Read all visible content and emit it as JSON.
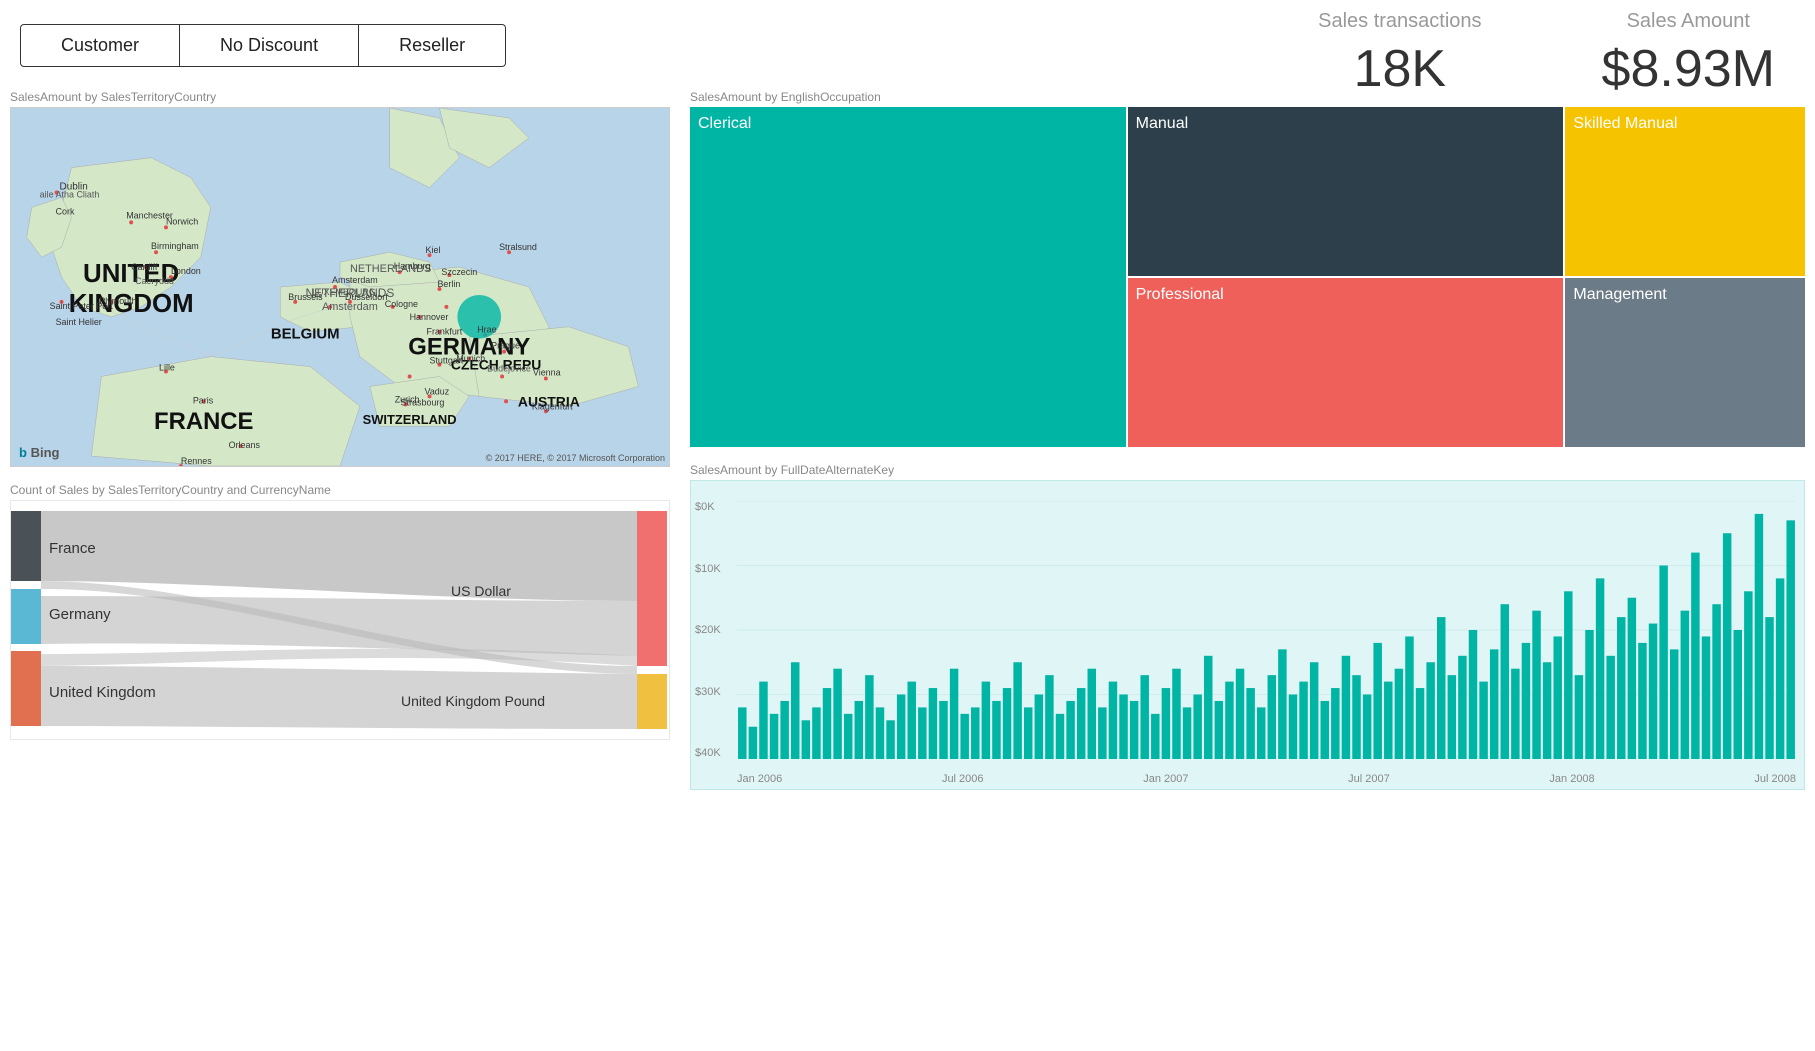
{
  "filters": [
    {
      "label": "Customer",
      "id": "customer"
    },
    {
      "label": "No Discount",
      "id": "no-discount"
    },
    {
      "label": "Reseller",
      "id": "reseller"
    }
  ],
  "kpi": {
    "transactions": {
      "label": "Sales transactions",
      "value": "18K"
    },
    "amount": {
      "label": "Sales Amount",
      "value": "$8.93M"
    }
  },
  "map": {
    "title": "SalesAmount by SalesTerritoryCountry",
    "copyright": "© 2017 HERE, © 2017 Microsoft Corporation",
    "countries": [
      "UNITED KINGDOM",
      "GERMANY",
      "FRANCE"
    ],
    "bing_label": "Bing"
  },
  "treemap": {
    "title": "SalesAmount by EnglishOccupation",
    "cells": [
      {
        "label": "Clerical",
        "color": "#00b5a4",
        "span_rows": 2
      },
      {
        "label": "Manual",
        "color": "#2d3f4a"
      },
      {
        "label": "Skilled Manual",
        "color": "#f5c300"
      },
      {
        "label": "Professional",
        "color": "#f0605a"
      },
      {
        "label": "Management",
        "color": "#6b7b87"
      }
    ]
  },
  "sankey": {
    "title": "Count of Sales by SalesTerritoryCountry and CurrencyName",
    "left_nodes": [
      {
        "label": "France",
        "color": "#4a5157"
      },
      {
        "label": "Germany",
        "color": "#5bb8d4"
      },
      {
        "label": "United Kingdom",
        "color": "#e07050"
      }
    ],
    "right_nodes": [
      {
        "label": "US Dollar",
        "color": "#f07070"
      },
      {
        "label": "United Kingdom Pound",
        "color": "#f0c040"
      }
    ]
  },
  "timeseries": {
    "title": "SalesAmount by FullDateAlternateKey",
    "y_labels": [
      "$0K",
      "$10K",
      "$20K",
      "$30K",
      "$40K"
    ],
    "x_labels": [
      "Jan 2006",
      "Jul 2006",
      "Jan 2007",
      "Jul 2007",
      "Jan 2008",
      "Jul 2008"
    ]
  }
}
